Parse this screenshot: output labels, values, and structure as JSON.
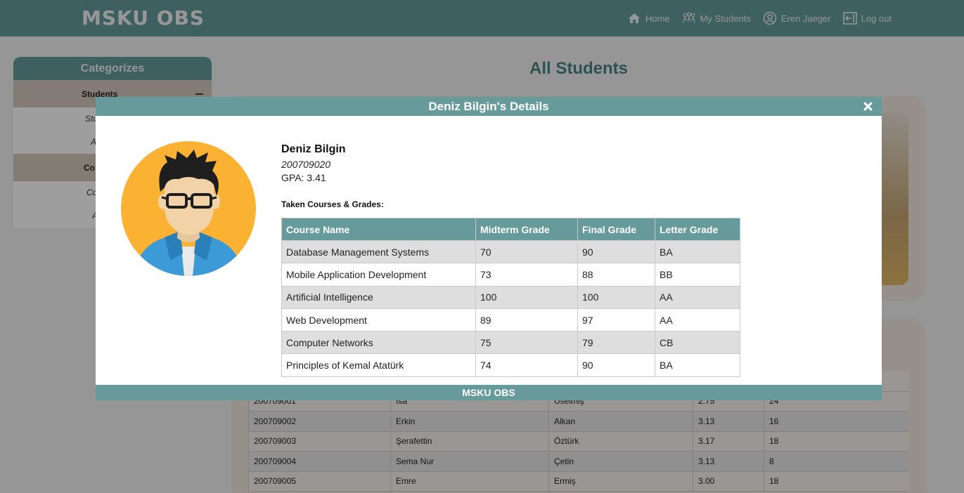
{
  "header": {
    "brand": "MSKU OBS",
    "nav": [
      {
        "label": "Home",
        "icon": "home-icon"
      },
      {
        "label": "My Students",
        "icon": "students-icon"
      },
      {
        "label": "Eren Jaeger",
        "icon": "user-icon"
      },
      {
        "label": "Log out",
        "icon": "logout-icon"
      }
    ]
  },
  "sidebar": {
    "title": "Categorizes",
    "group1": "Students",
    "sub1": "Stu",
    "sub2": "A",
    "group2": "Co",
    "sub3": "Co",
    "sub4": "A"
  },
  "main": {
    "title": "All Students"
  },
  "background_table": {
    "rows": [
      [
        "200709001",
        "İsa",
        "Üselmiş",
        "2.75",
        "24"
      ],
      [
        "200709002",
        "Erkin",
        "Alkan",
        "3.13",
        "16"
      ],
      [
        "200709003",
        "Şerafettin",
        "Öztürk",
        "3.17",
        "18"
      ],
      [
        "200709004",
        "Sema Nur",
        "Çetin",
        "3.13",
        "8"
      ],
      [
        "200709005",
        "Emre",
        "Ermiş",
        "3.00",
        "18"
      ]
    ]
  },
  "modal": {
    "title": "Deniz Bilgin's Details",
    "footer": "MSKU OBS",
    "student": {
      "name": "Deniz Bilgin",
      "id": "200709020",
      "gpa_label": "GPA:",
      "gpa": "3.41"
    },
    "courses_label": "Taken Courses & Grades:",
    "columns": [
      "Course Name",
      "Midterm Grade",
      "Final Grade",
      "Letter Grade"
    ],
    "rows": [
      [
        "Database Management Systems",
        "70",
        "90",
        "BA"
      ],
      [
        "Mobile Application Development",
        "73",
        "88",
        "BB"
      ],
      [
        "Artificial Intelligence",
        "100",
        "100",
        "AA"
      ],
      [
        "Web Development",
        "89",
        "97",
        "AA"
      ],
      [
        "Computer Networks",
        "75",
        "79",
        "CB"
      ],
      [
        "Principles of Kemal Atatürk",
        "74",
        "90",
        "BA"
      ]
    ]
  },
  "colors": {
    "accent": "#679b9b",
    "title_teal": "#4a8585",
    "avatar_bg": "#fbb131",
    "jacket": "#3c9bd6"
  }
}
